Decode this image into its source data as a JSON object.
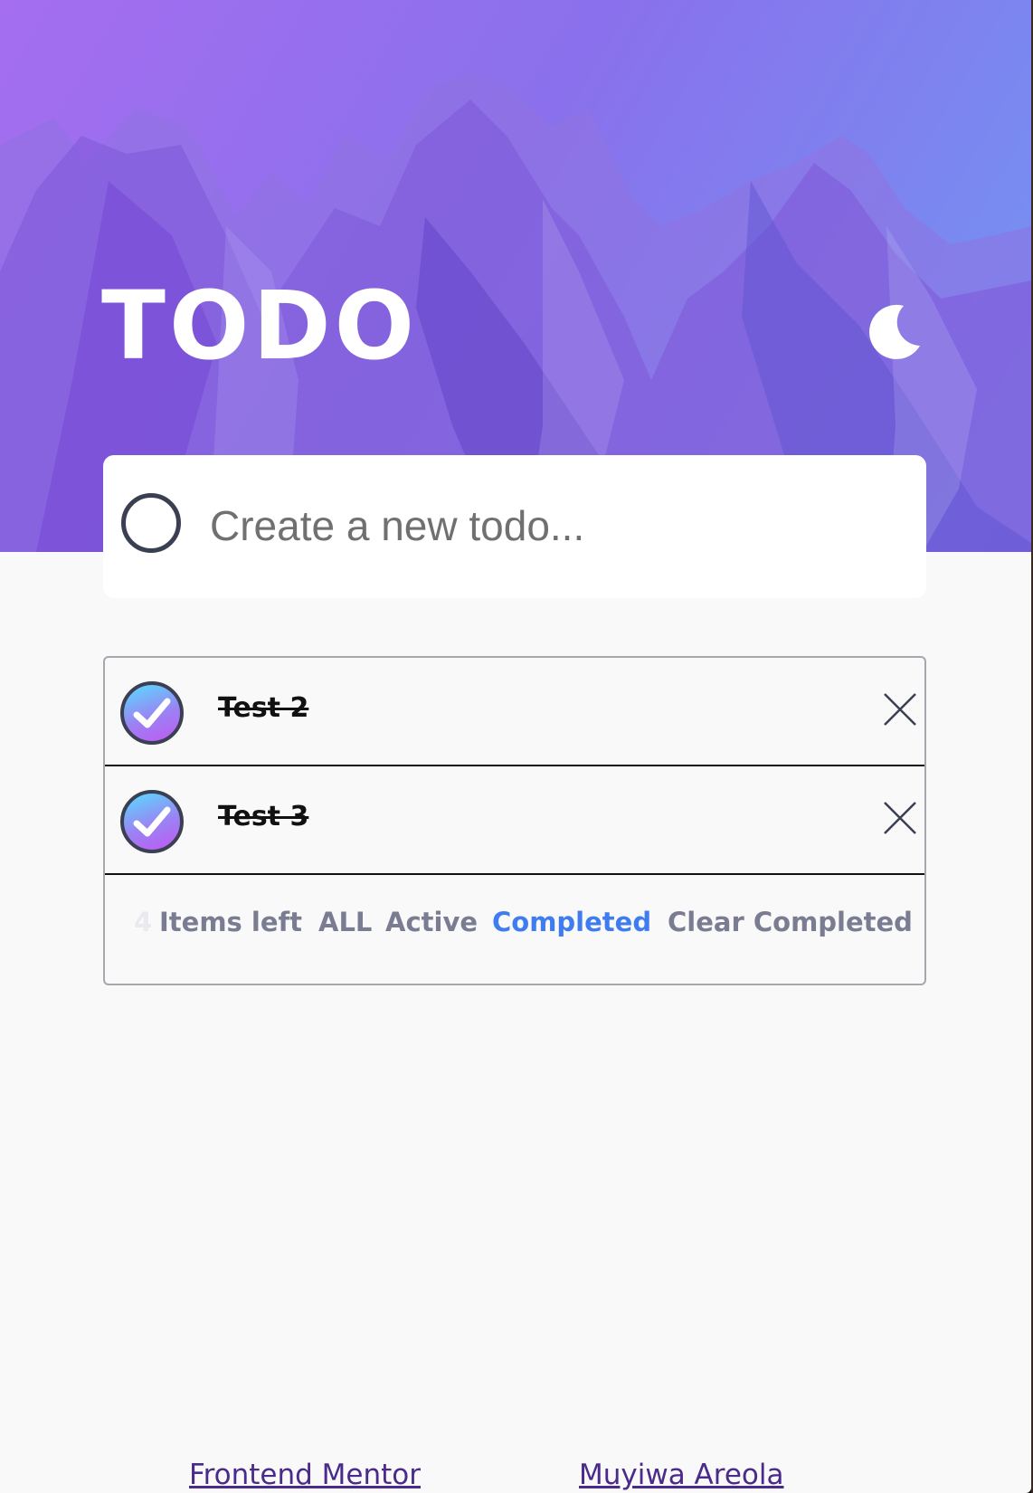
{
  "header": {
    "title": "TODO",
    "theme_toggle_icon": "moon-icon"
  },
  "new_todo": {
    "placeholder": "Create a new todo...",
    "value": ""
  },
  "todos": [
    {
      "label": "Test 2",
      "completed": true
    },
    {
      "label": "Test 3",
      "completed": true
    }
  ],
  "footer": {
    "count": "4",
    "items_left_label": "Items left",
    "filters": {
      "all": "ALL",
      "active": "Active",
      "completed": "Completed"
    },
    "active_filter": "Completed",
    "clear_completed": "Clear Completed"
  },
  "credits": {
    "frontend_mentor": "Frontend Mentor",
    "author": "Muyiwa Areola"
  },
  "colors": {
    "accent_blue": "#3f7cf0",
    "check_gradient_start": "#57ddff",
    "check_gradient_end": "#c058f3",
    "page_background": "#f9f9f9"
  }
}
